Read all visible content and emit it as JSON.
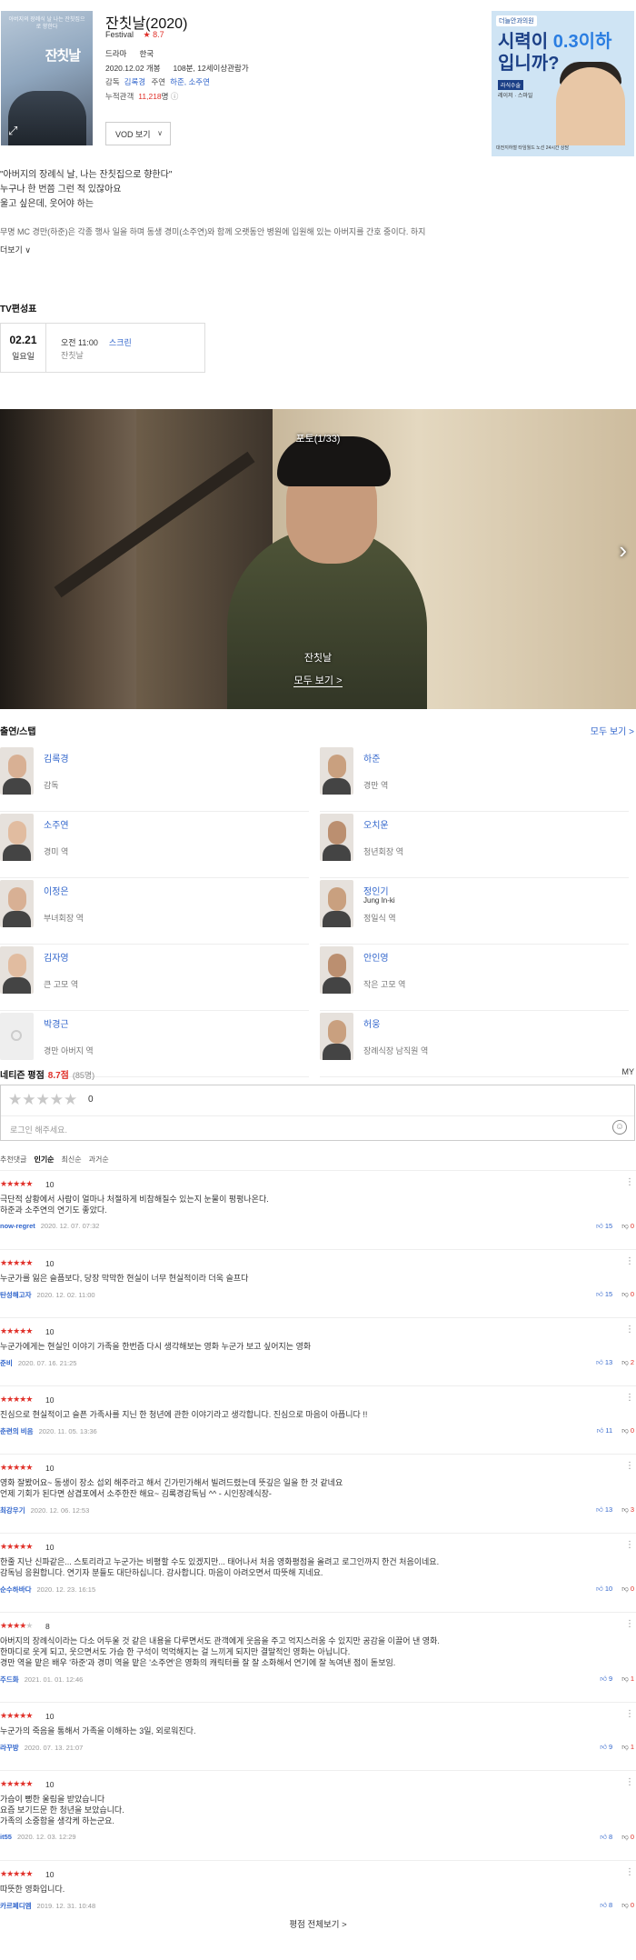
{
  "header": {
    "poster_title": "잔칫날",
    "poster_tagline": "아버지의 장례식 날 나는 잔칫집으로 향한다",
    "title": "잔칫날(2020)",
    "status": "Festival",
    "rating_star": "★",
    "rating": "8.7",
    "genre": "드라마",
    "country": "한국",
    "release": "2020.12.02 개봉",
    "runtime": "108분, 12세이상관람가",
    "director_label": "감독",
    "director": "김록경",
    "cast_label": "주연",
    "cast": "하준, 소주연",
    "audience_label": "누적관객",
    "audience": "11,218",
    "audience_unit": "명",
    "vod_button": "VOD 보기",
    "expand_icon": "expand-icon"
  },
  "ad": {
    "logo": "더늘안과의원",
    "headline_1": "시력이",
    "headline_highlight": "0.3이하",
    "headline_2": "입니까?",
    "tag": "라식수술",
    "small": "레이저 · 스마일",
    "foot": "대전지하철 타임월드 노선 24시간 상담"
  },
  "quote": [
    "\"아버지의 장례식 날, 나는 잔칫집으로 향한다\"",
    "누구나 한 번쯤 그런 적 있잖아요",
    "울고 싶은데, 웃어야 하는"
  ],
  "synopsis": "무명 MC 경만(하준)은 각종 행사 일을 하며 동생 경미(소주연)와 함께 오랫동안 병원에 입원해 있는 아버지를 간호 중이다. 하지",
  "more_label": "더보기",
  "tv": {
    "title": "TV편성표",
    "date": "02.21",
    "weekday": "일요일",
    "time": "오전 11:00",
    "channel": "스크린",
    "program": "잔칫날"
  },
  "photo": {
    "counter": "포토(1/33)",
    "caption": "잔칫날",
    "view_all": "모두 보기 >",
    "next_icon": "›"
  },
  "cast_section": {
    "title": "출연/스탭",
    "view_all": "모두 보기 >",
    "items": [
      {
        "name": "김록경",
        "en": "",
        "role": "감독",
        "photo": "person",
        "col": 0,
        "row": 0
      },
      {
        "name": "하준",
        "en": "",
        "role": "경만 역",
        "photo": "person",
        "col": 1,
        "row": 0
      },
      {
        "name": "소주연",
        "en": "",
        "role": "경미 역",
        "photo": "person",
        "col": 0,
        "row": 1
      },
      {
        "name": "오치운",
        "en": "",
        "role": "청년회장 역",
        "photo": "person",
        "col": 1,
        "row": 1
      },
      {
        "name": "이정은",
        "en": "",
        "role": "부녀회장 역",
        "photo": "person",
        "col": 0,
        "row": 2
      },
      {
        "name": "정인기",
        "en": "Jung In-ki",
        "role": "정일식 역",
        "photo": "person",
        "col": 1,
        "row": 2
      },
      {
        "name": "김자영",
        "en": "",
        "role": "큰 고모 역",
        "photo": "person",
        "col": 0,
        "row": 3
      },
      {
        "name": "안인영",
        "en": "",
        "role": "작은 고모 역",
        "photo": "person",
        "col": 1,
        "row": 3
      },
      {
        "name": "박경근",
        "en": "",
        "role": "경만 아버지 역",
        "photo": "empty",
        "col": 0,
        "row": 4
      },
      {
        "name": "허웅",
        "en": "",
        "role": "장례식장 남직원 역",
        "photo": "person",
        "col": 1,
        "row": 4
      }
    ]
  },
  "ratings": {
    "title": "네티즌 평점",
    "score": "8.7점",
    "count": "(85명)",
    "my": "MY",
    "input_stars": "★★★★★",
    "input_value": "0",
    "login_prompt": "로그인 해주세요.",
    "sort": [
      "추천댓글",
      "인기순",
      "최신순",
      "과거순"
    ],
    "reviews": [
      {
        "stars": 5,
        "score": "10",
        "lines": [
          "극단적 상황에서 사람이 얼마나 처절하게 비참해질수 있는지 눈물이 펑펑나온다.",
          "하준과 소주연의 연기도 좋았다."
        ],
        "user": "now-regret",
        "date": "2020. 12. 07. 07:32",
        "up": "15",
        "down": "0"
      },
      {
        "stars": 5,
        "score": "10",
        "lines": [
          "누군가를 잃은 슬픔보다, 당장 막막한 현실이 너무 현실적이라 더욱 슬프다"
        ],
        "user": "탄성해고자",
        "date": "2020. 12. 02. 11:00",
        "up": "15",
        "down": "0"
      },
      {
        "stars": 5,
        "score": "10",
        "lines": [
          "누군가에게는 현실인 이야기 가족을 한번즘 다시 생각해보는 영화 누군가 보고 싶어지는 영화"
        ],
        "user": "준비",
        "date": "2020. 07. 16. 21:25",
        "up": "13",
        "down": "2"
      },
      {
        "stars": 5,
        "score": "10",
        "lines": [
          "진심으로 현실적이고 슬픈 가족사를 지닌 한 청년에 관한 이야기라고 생각합니다. 진심으로 마음이 아픕니다 !!"
        ],
        "user": "춘련의 비음",
        "date": "2020. 11. 05. 13:36",
        "up": "11",
        "down": "0"
      },
      {
        "stars": 5,
        "score": "10",
        "lines": [
          "영화 잘봤어요~ 동생이 장소 섭외 해주라고 해서 긴가민가해서 빌려드렸는데 뜻깊은 일을 한 것 같네요",
          "언제 기회가 된다면 삼겹포에서 소주한잔 해요~ 김록경감독님 ^^ - 시인장례식장-"
        ],
        "user": "최강우기",
        "date": "2020. 12. 06. 12:53",
        "up": "13",
        "down": "3"
      },
      {
        "stars": 5,
        "score": "10",
        "lines": [
          "한줄 지난 신파같은... 스토리라고 누군가는 비평할 수도 있겠지만... 태어나서 처음 영화평점을 올려고 로그인까지 한건 처음이네요.",
          "감독님 응원합니다. 연기자 분들도 대단하십니다. 감사합니다. 마음이 아려오면서 따뜻해 지네요."
        ],
        "user": "순수하바다",
        "date": "2020. 12. 23. 16:15",
        "up": "10",
        "down": "0"
      },
      {
        "stars": 4,
        "score": "8",
        "lines": [
          "아버지의 장례식이라는 다소 어두울 것 같은 내용을 다루면서도 관객에게 웃음을 주고 억지스러움 수 있지만 공감을 이끌어 낸 영화.",
          "한마디로 웃게 되고, 웃으면서도 가슴 한 구석이 먹먹해지는 걸 느끼게 되지만 결말적인 영화는 아닙니다.",
          "경만 역을 맡은 배우 '하준'과 경미 역을 맡은 '소주연'은 영화의 캐릭터를 잘 잘 소화해서 연기에 잘 녹여낸 점이 돋보임."
        ],
        "user": "주드화",
        "date": "2021. 01. 01. 12:46",
        "up": "9",
        "down": "1"
      },
      {
        "stars": 5,
        "score": "10",
        "lines": [
          "누군가의 죽음을 통해서 가족을 이해하는 3일, 외로워진다."
        ],
        "user": "라꾸방",
        "date": "2020. 07. 13. 21:07",
        "up": "9",
        "down": "1"
      },
      {
        "stars": 5,
        "score": "10",
        "lines": [
          "가슴이 뻥한 울림을 받았습니다",
          "요즘 보기드문 한 청년을 보았습니다.",
          "가족의 소중함을 생각케 하는군요."
        ],
        "user": "it55",
        "date": "2020. 12. 03. 12:29",
        "up": "8",
        "down": "0"
      },
      {
        "stars": 5,
        "score": "10",
        "lines": [
          "따뜻한 영화입니다."
        ],
        "user": "카르페디엠",
        "date": "2019. 12. 31. 10:48",
        "up": "8",
        "down": "0"
      }
    ],
    "all_reviews": "평점 전체보기 >"
  },
  "colors": {
    "accent": "#3266cc",
    "rating": "#e0312a"
  }
}
